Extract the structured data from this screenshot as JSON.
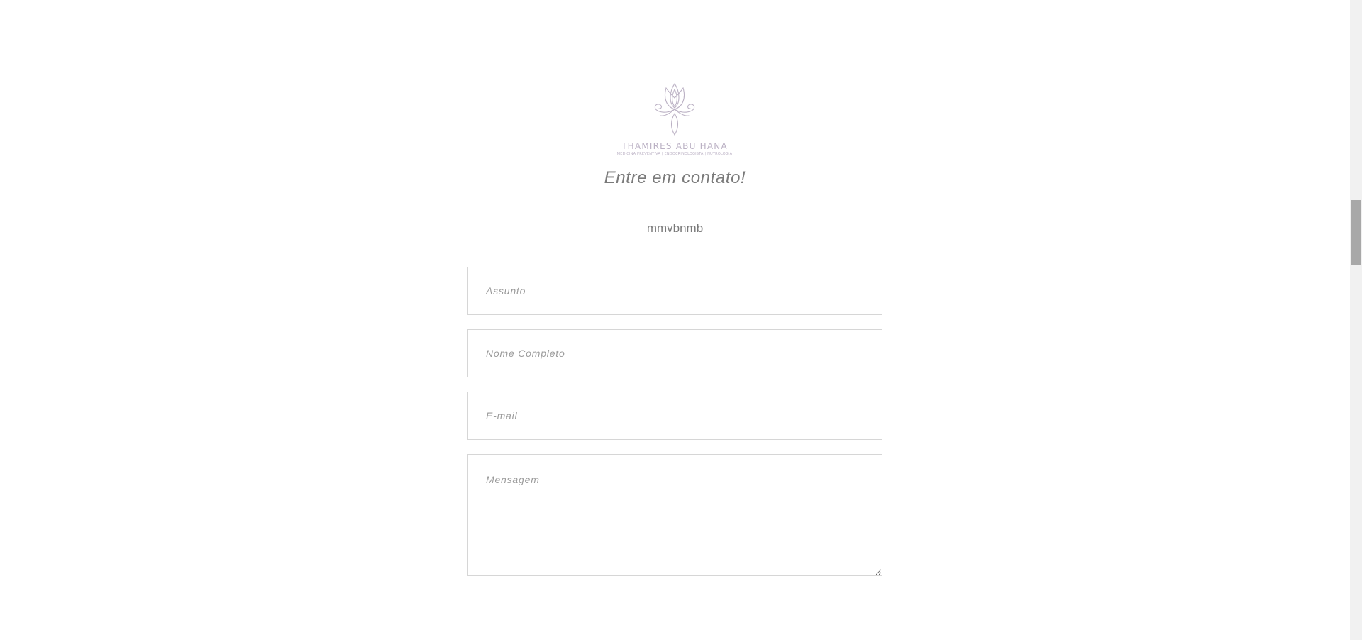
{
  "brand": {
    "name": "THAMIRES ABU HANA",
    "tagline": "MEDICINA PREVENTIVA | ENDOCRINOLOGISTA | NUTROLOGIA",
    "color": "#bbb1c4"
  },
  "contact": {
    "title": "Entre em contato!",
    "subtitle": "mmvbnmb"
  },
  "form": {
    "subject_placeholder": "Assunto",
    "name_placeholder": "Nome Completo",
    "email_placeholder": "E-mail",
    "message_placeholder": "Mensagem"
  },
  "colors": {
    "text": "#7a7a7a",
    "border": "#d6d6d6",
    "placeholder": "#9b9b9b"
  }
}
